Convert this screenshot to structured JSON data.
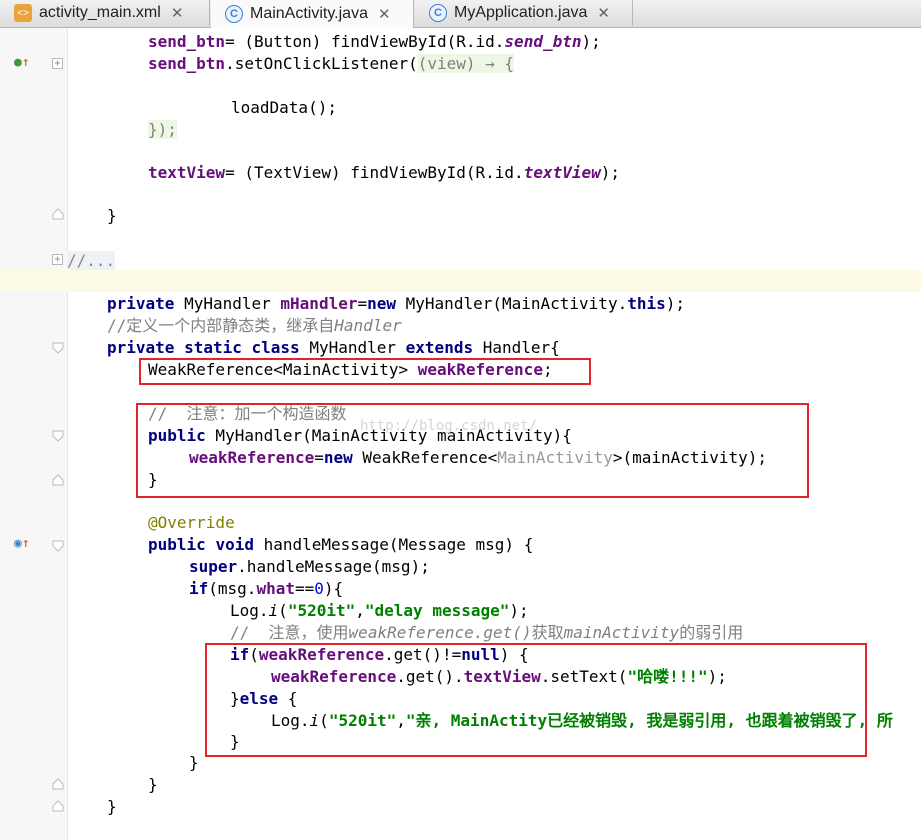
{
  "tabs": [
    {
      "label": "activity_main.xml",
      "icon": "xml-file-icon",
      "active": false
    },
    {
      "label": "MainActivity.java",
      "icon": "java-class-icon",
      "active": true
    },
    {
      "label": "MyApplication.java",
      "icon": "java-class-icon",
      "active": false
    }
  ],
  "code": {
    "l1": "send_btn= (Button) findViewById(R.id.send_btn);",
    "l2": "send_btn.setOnClickListener((view) → {",
    "l3": "loadData();",
    "l4": "});",
    "l5": "textView= (TextView) findViewById(R.id.textView);",
    "l6": "}",
    "l7": "//...",
    "l8": "private MyHandler mHandler=new MyHandler(MainActivity.this);",
    "l9": "//定义一个内部静态类，继承自Handler",
    "l10": "private static class MyHandler extends Handler{",
    "l11": "WeakReference<MainActivity> weakReference;",
    "l12": "//  注意：加一个构造函数",
    "l13": "public MyHandler(MainActivity mainActivity){",
    "l14": "weakReference=new WeakReference<MainActivity>(mainActivity);",
    "l15": "}",
    "l16": "@Override",
    "l17": "public void handleMessage(Message msg) {",
    "l18": "super.handleMessage(msg);",
    "l19": "if(msg.what==0){",
    "l20": "Log.i(\"520it\",\"delay message\");",
    "l21": "//  注意，使用weakReference.get()获取mainActivity的弱引用",
    "l22": "if(weakReference.get()!=null) {",
    "l23": "weakReference.get().textView.setText(\"哈喽!!!\");",
    "l24": "}else {",
    "l25": "Log.i(\"520it\",\"亲, MainActity已经被销毁, 我是弱引用, 也跟着被销毁了, 所",
    "l26": "}",
    "l27": "}",
    "l28": "}",
    "l29": "}"
  },
  "tokens": {
    "send_btn": "send_btn",
    "button_cast": "= (Button) findViewById(R.id.",
    "send_btn_id": "send_btn",
    "close_paren": ");",
    "set_listener": ".setOnClickListener(",
    "lambda": "(view) → {",
    "load": "loadData();",
    "lambda_end": "});",
    "textView": "textView",
    "tv_cast": "= (TextView) findViewById(R.id.",
    "textView_id": "textView",
    "brace_close": "}",
    "folded": "//...",
    "private": "private",
    "myhandler_type": " MyHandler ",
    "mHandler": "mHandler",
    "eq": "=",
    "new": "new",
    "myhandler_ctor": " MyHandler(MainActivity.",
    "this": "this",
    "comment_cn": "//定义一个内部静态类，继承自",
    "comment_handler": "Handler",
    "static": "static",
    "class": "class",
    "myhandler_name": " MyHandler ",
    "extends": "extends",
    "handler_brace": " Handler{",
    "weakref_type": "WeakReference<MainActivity> ",
    "weakReference": "weakReference",
    "semicolon": ";",
    "ctor_comment": "//  注意：加一个构造函数",
    "public": "public",
    "ctor_sig": " MyHandler(MainActivity mainActivity){",
    "weakref_new": " WeakReference<",
    "main_activity_gray": "MainActivity",
    "ctor_arg": ">(mainActivity);",
    "override": "@Override",
    "void": "void",
    "handle_sig": " handleMessage(Message msg) {",
    "super": "super",
    "super_call": ".handleMessage(msg);",
    "if": "if",
    "msg_open": "(msg.",
    "what": "what",
    "eqeq": "==",
    "zero": "0",
    "brace_open_paren": "){",
    "log": "Log.",
    "i": "i",
    "open_paren": "(",
    "tag": "\"520it\"",
    "comma": ",",
    "delay_msg": "\"delay message\"",
    "comment2_a": "//  注意，使用",
    "comment2_b": "weakReference.get()",
    "comment2_c": "获取",
    "comment2_d": "mainActivity",
    "comment2_e": "的弱引用",
    "get_neq": ".get()!=",
    "null": "null",
    "paren_brace": ") {",
    "get_dot": ".get().",
    "set_text": ".setText(",
    "hello": "\"哈喽!!!\"",
    "else_open": "}",
    "else": "else",
    "brace_open": " {",
    "destroyed_msg": "\"亲, MainActity已经被销毁, 我是弱引用, 也跟着被销毁了, 所"
  },
  "watermark": "http://blog.csdn.net/"
}
